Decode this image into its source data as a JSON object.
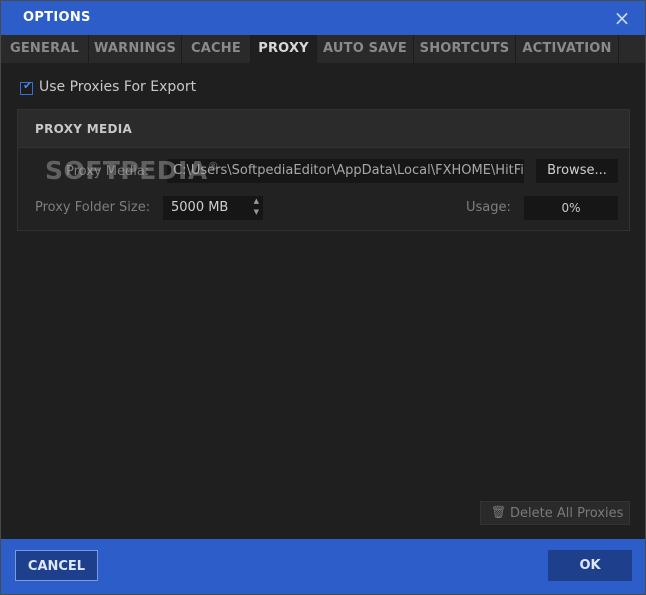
{
  "window": {
    "title": "OPTIONS",
    "close_icon": "×"
  },
  "tabs": [
    {
      "label": "GENERAL"
    },
    {
      "label": "WARNINGS"
    },
    {
      "label": "CACHE"
    },
    {
      "label": "PROXY",
      "active": true
    },
    {
      "label": "AUTO SAVE"
    },
    {
      "label": "SHORTCUTS"
    },
    {
      "label": "ACTIVATION"
    }
  ],
  "proxy": {
    "use_proxies_checked": true,
    "check_mark": "✔",
    "use_proxies_label": "Use Proxies For Export",
    "group_title": "PROXY MEDIA",
    "media_label": "Proxy Media:",
    "media_path": "C:\\Users\\SoftpediaEditor\\AppData\\Local\\FXHOME\\HitFil",
    "browse_label": "Browse...",
    "folder_size_label": "Proxy Folder Size:",
    "folder_size_value": "5000 MB",
    "spin_up": "▲",
    "spin_down": "▼",
    "usage_label": "Usage:",
    "usage_value": "0%",
    "watermark": "SOFTPEDIA",
    "watermark_mark": "®",
    "delete_icon": "🗑",
    "delete_label": "Delete All Proxies"
  },
  "footer": {
    "cancel_label": "CANCEL",
    "ok_label": "OK"
  },
  "colors": {
    "accent": "#2c5dc8",
    "button_dark": "#1e3f8c",
    "background": "#1f1f1f"
  }
}
